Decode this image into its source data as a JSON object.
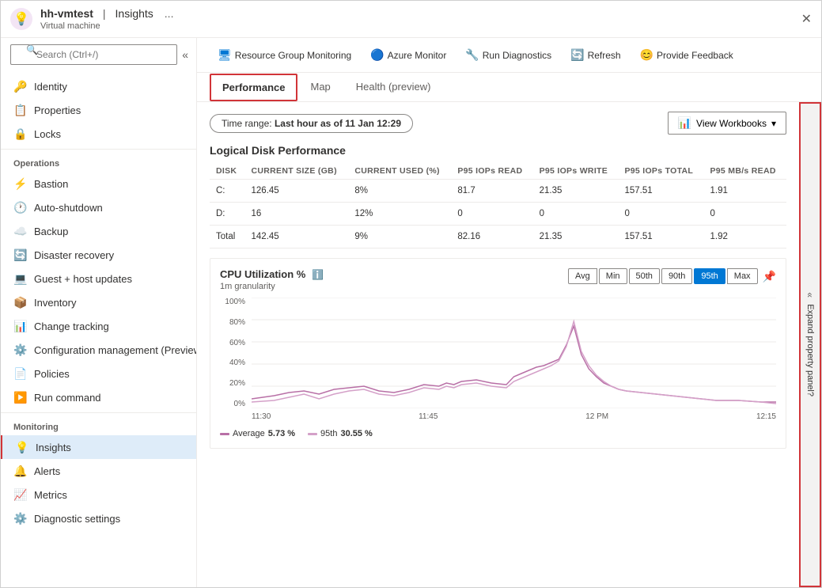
{
  "window": {
    "title": "hh-vmtest",
    "separator": "|",
    "page": "Insights",
    "subtitle": "Virtual machine",
    "dots": "..."
  },
  "sidebar": {
    "search_placeholder": "Search (Ctrl+/)",
    "items_above": [
      {
        "id": "identity",
        "label": "Identity",
        "icon": "🔑"
      },
      {
        "id": "properties",
        "label": "Properties",
        "icon": "📋"
      },
      {
        "id": "locks",
        "label": "Locks",
        "icon": "🔒"
      }
    ],
    "section_operations": "Operations",
    "items_operations": [
      {
        "id": "bastion",
        "label": "Bastion",
        "icon": "⚡"
      },
      {
        "id": "auto-shutdown",
        "label": "Auto-shutdown",
        "icon": "🕐"
      },
      {
        "id": "backup",
        "label": "Backup",
        "icon": "☁️"
      },
      {
        "id": "disaster-recovery",
        "label": "Disaster recovery",
        "icon": "🔄"
      },
      {
        "id": "guest-host-updates",
        "label": "Guest + host updates",
        "icon": "💻"
      },
      {
        "id": "inventory",
        "label": "Inventory",
        "icon": "📦"
      },
      {
        "id": "change-tracking",
        "label": "Change tracking",
        "icon": "📊"
      },
      {
        "id": "config-management",
        "label": "Configuration management (Preview)",
        "icon": "⚙️"
      },
      {
        "id": "policies",
        "label": "Policies",
        "icon": "📄"
      },
      {
        "id": "run-command",
        "label": "Run command",
        "icon": "▶️"
      }
    ],
    "section_monitoring": "Monitoring",
    "items_monitoring": [
      {
        "id": "insights",
        "label": "Insights",
        "icon": "💡",
        "active": true
      },
      {
        "id": "alerts",
        "label": "Alerts",
        "icon": "🔔"
      },
      {
        "id": "metrics",
        "label": "Metrics",
        "icon": "📈"
      },
      {
        "id": "diagnostic-settings",
        "label": "Diagnostic settings",
        "icon": "⚙️"
      }
    ]
  },
  "toolbar": {
    "items": [
      {
        "id": "resource-group-monitoring",
        "label": "Resource Group Monitoring",
        "icon": "🖥"
      },
      {
        "id": "azure-monitor",
        "label": "Azure Monitor",
        "icon": "🔵"
      },
      {
        "id": "run-diagnostics",
        "label": "Run Diagnostics",
        "icon": "🔧"
      },
      {
        "id": "refresh",
        "label": "Refresh",
        "icon": "🔄"
      },
      {
        "id": "provide-feedback",
        "label": "Provide Feedback",
        "icon": "😊"
      }
    ]
  },
  "tabs": [
    {
      "id": "performance",
      "label": "Performance",
      "active": true,
      "bordered": true
    },
    {
      "id": "map",
      "label": "Map",
      "active": false
    },
    {
      "id": "health",
      "label": "Health (preview)",
      "active": false
    }
  ],
  "main": {
    "time_range_label": "Time range:",
    "time_range_value": "Last hour as of 11 Jan 12:29",
    "view_workbooks_label": "View Workbooks",
    "disk_section_title": "Logical Disk Performance",
    "disk_table": {
      "columns": [
        "DISK",
        "CURRENT SIZE (GB)",
        "CURRENT USED (%)",
        "P95 IOPs READ",
        "P95 IOPs WRITE",
        "P95 IOPs TOTAL",
        "P95 MB/s READ"
      ],
      "rows": [
        {
          "disk": "C:",
          "size": "126.45",
          "used": "8%",
          "iops_read": "81.7",
          "iops_write": "21.35",
          "iops_total": "157.51",
          "mb_read": "1.91"
        },
        {
          "disk": "D:",
          "size": "16",
          "used": "12%",
          "iops_read": "0",
          "iops_write": "0",
          "iops_total": "0",
          "mb_read": "0"
        },
        {
          "disk": "Total",
          "size": "142.45",
          "used": "9%",
          "iops_read": "82.16",
          "iops_write": "21.35",
          "iops_total": "157.51",
          "mb_read": "1.92"
        }
      ]
    },
    "chart": {
      "title": "CPU Utilization %",
      "subtitle": "1m granularity",
      "btn_group": [
        "Avg",
        "Min",
        "50th",
        "90th",
        "95th",
        "Max"
      ],
      "active_btn": "95th",
      "y_labels": [
        "100%",
        "80%",
        "60%",
        "40%",
        "20%",
        "0%"
      ],
      "x_labels": [
        "11:30",
        "11:45",
        "12 PM",
        "12:15"
      ],
      "legend": [
        {
          "label": "Average",
          "value": "5.73 %",
          "color": "#b86fa6"
        },
        {
          "label": "95th",
          "value": "30.55 %",
          "color": "#d4a0c8"
        }
      ]
    }
  },
  "right_panel": {
    "expand_label": "Expand property panel?"
  }
}
